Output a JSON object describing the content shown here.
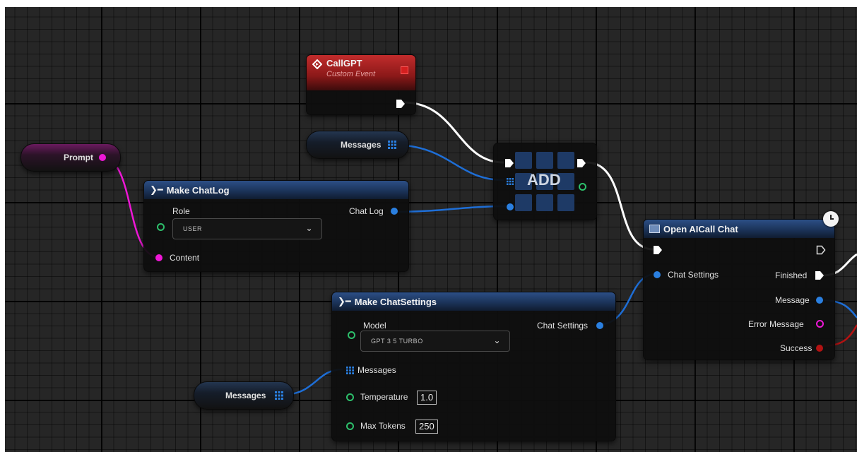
{
  "nodes": {
    "call_gpt": {
      "title": "CallGPT",
      "subtitle": "Custom Event"
    },
    "messages_var_top": {
      "label": "Messages"
    },
    "prompt_var": {
      "label": "Prompt"
    },
    "make_chatlog": {
      "title": "Make ChatLog",
      "role_label": "Role",
      "role_value": "USER",
      "content_label": "Content",
      "output_label": "Chat Log"
    },
    "add": {
      "title": "ADD"
    },
    "open_aicall_chat": {
      "title": "Open AICall Chat",
      "chat_settings_label": "Chat Settings",
      "finished_label": "Finished",
      "message_label": "Message",
      "error_message_label": "Error Message",
      "success_label": "Success"
    },
    "make_chatsettings": {
      "title": "Make ChatSettings",
      "model_label": "Model",
      "model_value": "GPT 3 5 TURBO",
      "messages_label": "Messages",
      "temperature_label": "Temperature",
      "temperature_value": "1.0",
      "max_tokens_label": "Max Tokens",
      "max_tokens_value": "250",
      "output_label": "Chat Settings"
    },
    "messages_var_bottom": {
      "label": "Messages"
    }
  },
  "colors": {
    "object_pin": "#2a7fe0",
    "string_pin": "#ee17d6",
    "bool_pin": "#b31212",
    "float_pin": "#2dbf6b",
    "exec_wire": "#ffffff",
    "graph_background": "#262626"
  }
}
